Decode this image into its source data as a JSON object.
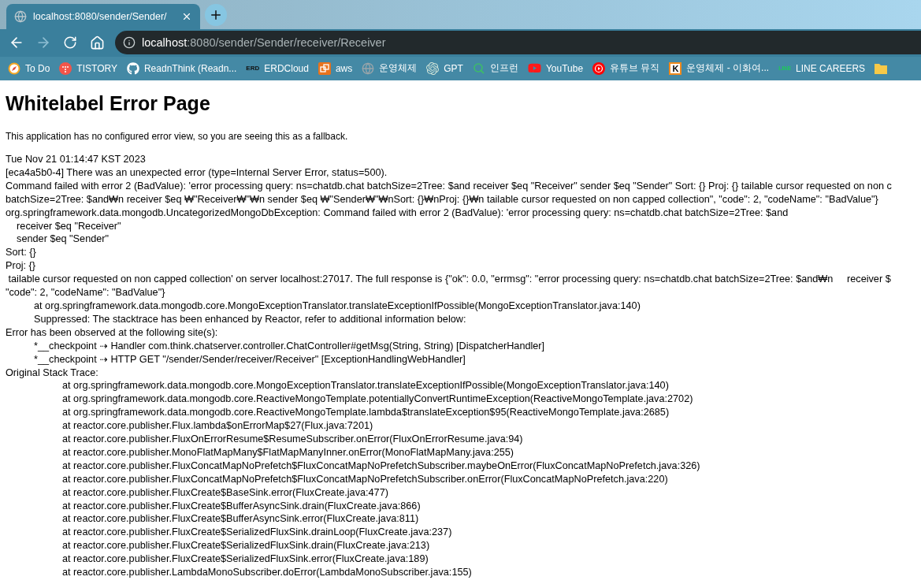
{
  "tab": {
    "title": "localhost:8080/sender/Sender/"
  },
  "address": {
    "host": "localhost",
    "path": ":8080/sender/Sender/receiver/Receiver"
  },
  "nav": {
    "back_disabled": false,
    "forward_disabled": true
  },
  "bookmarks": [
    {
      "kind": "todo",
      "label": "To Do"
    },
    {
      "kind": "tistory",
      "label": "TISTORY"
    },
    {
      "kind": "github",
      "label": "ReadnThink (Readn..."
    },
    {
      "kind": "erd",
      "label": "ERDCloud",
      "icon_text": "ERD"
    },
    {
      "kind": "aws",
      "label": "aws"
    },
    {
      "kind": "globe",
      "label": "운영체제"
    },
    {
      "kind": "gpt",
      "label": "GPT"
    },
    {
      "kind": "inflearn",
      "label": "인프런"
    },
    {
      "kind": "youtube",
      "label": "YouTube"
    },
    {
      "kind": "ytmusic",
      "label": "유튜브 뮤직"
    },
    {
      "kind": "kocw",
      "label": "운영체제 - 이화여...",
      "icon_text": "K"
    },
    {
      "kind": "line",
      "label": "LINE CAREERS",
      "icon_text": "LINE"
    },
    {
      "kind": "folder"
    }
  ],
  "page": {
    "heading": "Whitelabel Error Page",
    "intro": "This application has no configured error view, so you are seeing this as a fallback.",
    "lines": [
      "Tue Nov 21 01:14:47 KST 2023",
      "[eca4a5b0-4] There was an unexpected error (type=Internal Server Error, status=500).",
      "Command failed with error 2 (BadValue): 'error processing query: ns=chatdb.chat batchSize=2Tree: $and receiver $eq \"Receiver\" sender $eq \"Sender\" Sort: {} Proj: {} tailable cursor requested on non c",
      "batchSize=2Tree: $and₩n receiver $eq ₩\"Receiver₩\"₩n sender $eq ₩\"Sender₩\"₩nSort: {}₩nProj: {}₩n tailable cursor requested on non capped collection\", \"code\": 2, \"codeName\": \"BadValue\"}",
      "org.springframework.data.mongodb.UncategorizedMongoDbException: Command failed with error 2 (BadValue): 'error processing query: ns=chatdb.chat batchSize=2Tree: $and",
      "    receiver $eq \"Receiver\"",
      "    sender $eq \"Sender\"",
      "Sort: {}",
      "Proj: {}",
      " tailable cursor requested on non capped collection' on server localhost:27017. The full response is {\"ok\": 0.0, \"errmsg\": \"error processing query: ns=chatdb.chat batchSize=2Tree: $and₩n     receiver $",
      "\"code\": 2, \"codeName\": \"BadValue\"}",
      "\tat org.springframework.data.mongodb.core.MongoExceptionTranslator.translateExceptionIfPossible(MongoExceptionTranslator.java:140)",
      "\tSuppressed: The stacktrace has been enhanced by Reactor, refer to additional information below:",
      "Error has been observed at the following site(s):",
      "\t*__checkpoint ⇢ Handler com.think.chatserver.controller.ChatController#getMsg(String, String) [DispatcherHandler]",
      "\t*__checkpoint ⇢ HTTP GET \"/sender/Sender/receiver/Receiver\" [ExceptionHandlingWebHandler]",
      "Original Stack Trace:",
      "\t\tat org.springframework.data.mongodb.core.MongoExceptionTranslator.translateExceptionIfPossible(MongoExceptionTranslator.java:140)",
      "\t\tat org.springframework.data.mongodb.core.ReactiveMongoTemplate.potentiallyConvertRuntimeException(ReactiveMongoTemplate.java:2702)",
      "\t\tat org.springframework.data.mongodb.core.ReactiveMongoTemplate.lambda$translateException$95(ReactiveMongoTemplate.java:2685)",
      "\t\tat reactor.core.publisher.Flux.lambda$onErrorMap$27(Flux.java:7201)",
      "\t\tat reactor.core.publisher.FluxOnErrorResume$ResumeSubscriber.onError(FluxOnErrorResume.java:94)",
      "\t\tat reactor.core.publisher.MonoFlatMapMany$FlatMapManyInner.onError(MonoFlatMapMany.java:255)",
      "\t\tat reactor.core.publisher.FluxConcatMapNoPrefetch$FluxConcatMapNoPrefetchSubscriber.maybeOnError(FluxConcatMapNoPrefetch.java:326)",
      "\t\tat reactor.core.publisher.FluxConcatMapNoPrefetch$FluxConcatMapNoPrefetchSubscriber.onError(FluxConcatMapNoPrefetch.java:220)",
      "\t\tat reactor.core.publisher.FluxCreate$BaseSink.error(FluxCreate.java:477)",
      "\t\tat reactor.core.publisher.FluxCreate$BufferAsyncSink.drain(FluxCreate.java:866)",
      "\t\tat reactor.core.publisher.FluxCreate$BufferAsyncSink.error(FluxCreate.java:811)",
      "\t\tat reactor.core.publisher.FluxCreate$SerializedFluxSink.drainLoop(FluxCreate.java:237)",
      "\t\tat reactor.core.publisher.FluxCreate$SerializedFluxSink.drain(FluxCreate.java:213)",
      "\t\tat reactor.core.publisher.FluxCreate$SerializedFluxSink.error(FluxCreate.java:189)",
      "\t\tat reactor.core.publisher.LambdaMonoSubscriber.doError(LambdaMonoSubscriber.java:155)"
    ]
  }
}
